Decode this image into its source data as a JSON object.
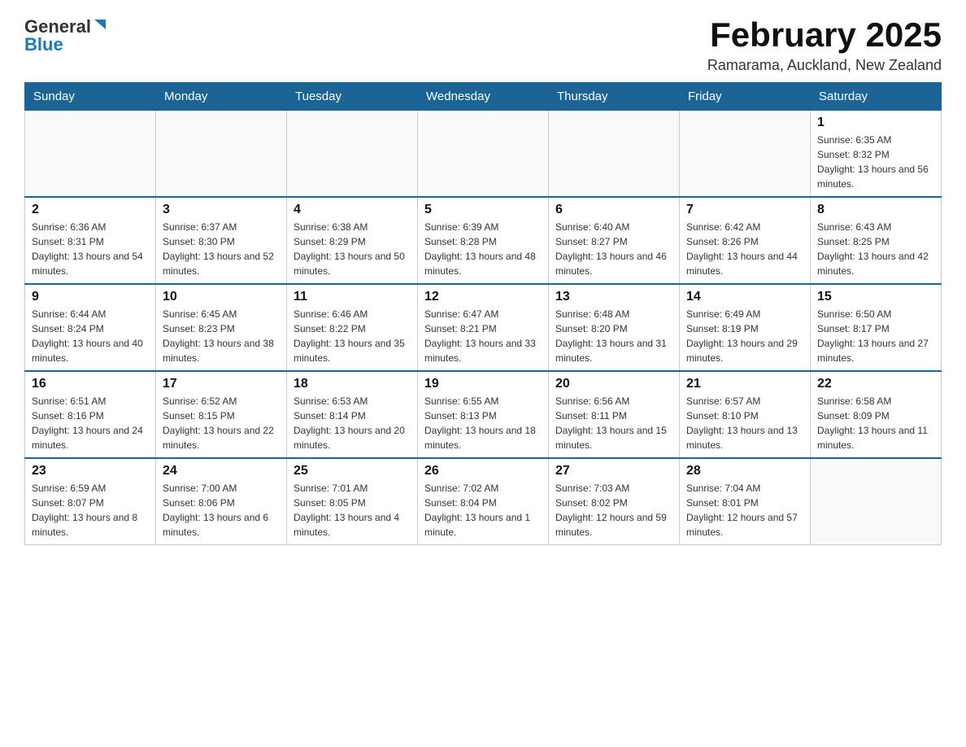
{
  "header": {
    "logo_main": "General",
    "logo_accent": "Blue",
    "month_title": "February 2025",
    "location": "Ramarama, Auckland, New Zealand"
  },
  "days_of_week": [
    "Sunday",
    "Monday",
    "Tuesday",
    "Wednesday",
    "Thursday",
    "Friday",
    "Saturday"
  ],
  "weeks": [
    {
      "days": [
        {
          "num": "",
          "info": ""
        },
        {
          "num": "",
          "info": ""
        },
        {
          "num": "",
          "info": ""
        },
        {
          "num": "",
          "info": ""
        },
        {
          "num": "",
          "info": ""
        },
        {
          "num": "",
          "info": ""
        },
        {
          "num": "1",
          "info": "Sunrise: 6:35 AM\nSunset: 8:32 PM\nDaylight: 13 hours and 56 minutes."
        }
      ]
    },
    {
      "days": [
        {
          "num": "2",
          "info": "Sunrise: 6:36 AM\nSunset: 8:31 PM\nDaylight: 13 hours and 54 minutes."
        },
        {
          "num": "3",
          "info": "Sunrise: 6:37 AM\nSunset: 8:30 PM\nDaylight: 13 hours and 52 minutes."
        },
        {
          "num": "4",
          "info": "Sunrise: 6:38 AM\nSunset: 8:29 PM\nDaylight: 13 hours and 50 minutes."
        },
        {
          "num": "5",
          "info": "Sunrise: 6:39 AM\nSunset: 8:28 PM\nDaylight: 13 hours and 48 minutes."
        },
        {
          "num": "6",
          "info": "Sunrise: 6:40 AM\nSunset: 8:27 PM\nDaylight: 13 hours and 46 minutes."
        },
        {
          "num": "7",
          "info": "Sunrise: 6:42 AM\nSunset: 8:26 PM\nDaylight: 13 hours and 44 minutes."
        },
        {
          "num": "8",
          "info": "Sunrise: 6:43 AM\nSunset: 8:25 PM\nDaylight: 13 hours and 42 minutes."
        }
      ]
    },
    {
      "days": [
        {
          "num": "9",
          "info": "Sunrise: 6:44 AM\nSunset: 8:24 PM\nDaylight: 13 hours and 40 minutes."
        },
        {
          "num": "10",
          "info": "Sunrise: 6:45 AM\nSunset: 8:23 PM\nDaylight: 13 hours and 38 minutes."
        },
        {
          "num": "11",
          "info": "Sunrise: 6:46 AM\nSunset: 8:22 PM\nDaylight: 13 hours and 35 minutes."
        },
        {
          "num": "12",
          "info": "Sunrise: 6:47 AM\nSunset: 8:21 PM\nDaylight: 13 hours and 33 minutes."
        },
        {
          "num": "13",
          "info": "Sunrise: 6:48 AM\nSunset: 8:20 PM\nDaylight: 13 hours and 31 minutes."
        },
        {
          "num": "14",
          "info": "Sunrise: 6:49 AM\nSunset: 8:19 PM\nDaylight: 13 hours and 29 minutes."
        },
        {
          "num": "15",
          "info": "Sunrise: 6:50 AM\nSunset: 8:17 PM\nDaylight: 13 hours and 27 minutes."
        }
      ]
    },
    {
      "days": [
        {
          "num": "16",
          "info": "Sunrise: 6:51 AM\nSunset: 8:16 PM\nDaylight: 13 hours and 24 minutes."
        },
        {
          "num": "17",
          "info": "Sunrise: 6:52 AM\nSunset: 8:15 PM\nDaylight: 13 hours and 22 minutes."
        },
        {
          "num": "18",
          "info": "Sunrise: 6:53 AM\nSunset: 8:14 PM\nDaylight: 13 hours and 20 minutes."
        },
        {
          "num": "19",
          "info": "Sunrise: 6:55 AM\nSunset: 8:13 PM\nDaylight: 13 hours and 18 minutes."
        },
        {
          "num": "20",
          "info": "Sunrise: 6:56 AM\nSunset: 8:11 PM\nDaylight: 13 hours and 15 minutes."
        },
        {
          "num": "21",
          "info": "Sunrise: 6:57 AM\nSunset: 8:10 PM\nDaylight: 13 hours and 13 minutes."
        },
        {
          "num": "22",
          "info": "Sunrise: 6:58 AM\nSunset: 8:09 PM\nDaylight: 13 hours and 11 minutes."
        }
      ]
    },
    {
      "days": [
        {
          "num": "23",
          "info": "Sunrise: 6:59 AM\nSunset: 8:07 PM\nDaylight: 13 hours and 8 minutes."
        },
        {
          "num": "24",
          "info": "Sunrise: 7:00 AM\nSunset: 8:06 PM\nDaylight: 13 hours and 6 minutes."
        },
        {
          "num": "25",
          "info": "Sunrise: 7:01 AM\nSunset: 8:05 PM\nDaylight: 13 hours and 4 minutes."
        },
        {
          "num": "26",
          "info": "Sunrise: 7:02 AM\nSunset: 8:04 PM\nDaylight: 13 hours and 1 minute."
        },
        {
          "num": "27",
          "info": "Sunrise: 7:03 AM\nSunset: 8:02 PM\nDaylight: 12 hours and 59 minutes."
        },
        {
          "num": "28",
          "info": "Sunrise: 7:04 AM\nSunset: 8:01 PM\nDaylight: 12 hours and 57 minutes."
        },
        {
          "num": "",
          "info": ""
        }
      ]
    }
  ]
}
